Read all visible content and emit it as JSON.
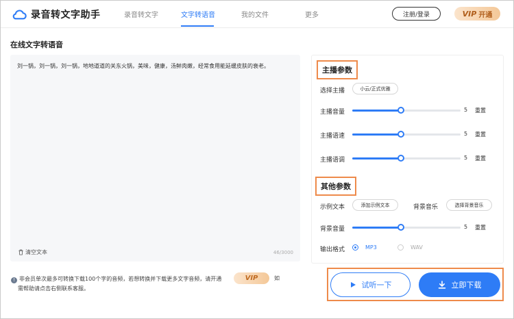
{
  "header": {
    "app_title": "录音转文字助手",
    "nav": [
      {
        "label": "录音转文字",
        "active": false
      },
      {
        "label": "文字转语音",
        "active": true
      },
      {
        "label": "我的文件",
        "active": false
      },
      {
        "label": "更多",
        "active": false
      }
    ],
    "login_label": "注册/登录",
    "vip_label": "VIP",
    "vip_sub": "开通"
  },
  "page_title": "在线文字转语音",
  "editor": {
    "text": "刘一锅，刘一锅，刘一锅，地地道道的关东火锅，美味，健康，汤鲜肉嫩，经常食用能延缓皮肤的衰老。",
    "clear_label": "清空文本",
    "char_count": "46/3000"
  },
  "notice": {
    "line1": "非会员单次最多可转换下载100个字的音频，若想转换并下载更多文字音频，请开通",
    "vip_badge": "VIP",
    "suffix": "如",
    "line2": "需帮助请点击右侧联系客服。"
  },
  "settings": {
    "host_title": "主播参数",
    "select_host_label": "选择主播",
    "selected_host": "小云/正式优雅",
    "reset_label": "重置",
    "host_sliders": [
      {
        "label": "主播音量",
        "value": 5,
        "fraction": 0.45
      },
      {
        "label": "主播语速",
        "value": 5,
        "fraction": 0.45
      },
      {
        "label": "主播语调",
        "value": 5,
        "fraction": 0.45
      }
    ],
    "other_title": "其他参数",
    "sample_text_label": "示例文本",
    "sample_text_button": "添加示例文本",
    "bg_music_label": "背景音乐",
    "bg_music_button": "选择背景音乐",
    "bg_volume": {
      "label": "背景音量",
      "value": 5,
      "fraction": 0.45
    },
    "format_label": "输出格式",
    "formats": [
      {
        "label": "MP3",
        "selected": true
      },
      {
        "label": "WAV",
        "selected": false
      }
    ]
  },
  "actions": {
    "preview_label": "试听一下",
    "download_label": "立即下载"
  },
  "colors": {
    "accent": "#2e7cf6",
    "highlight_border": "#ee8a4a",
    "vip_text": "#b05e1b"
  }
}
